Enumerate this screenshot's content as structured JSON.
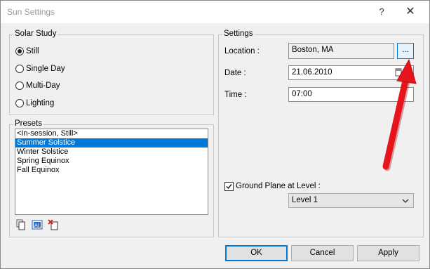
{
  "window": {
    "title": "Sun Settings",
    "help": "?",
    "close": "✕"
  },
  "solar_study": {
    "title": "Solar Study",
    "options": [
      {
        "label": "Still",
        "selected": true
      },
      {
        "label": "Single Day",
        "selected": false
      },
      {
        "label": "Multi-Day",
        "selected": false
      },
      {
        "label": "Lighting",
        "selected": false
      }
    ]
  },
  "presets": {
    "title": "Presets",
    "items": [
      "<In-session, Still>",
      "Summer Solstice",
      "Winter Solstice",
      "Spring Equinox",
      "Fall Equinox"
    ],
    "selected_index": 1,
    "icons": [
      "duplicate-icon",
      "rename-icon",
      "delete-icon"
    ]
  },
  "settings": {
    "title": "Settings",
    "location_label": "Location :",
    "location_value": "Boston, MA",
    "browse_label": "...",
    "date_label": "Date :",
    "date_value": "21.06.2010",
    "time_label": "Time :",
    "time_value": "07:00",
    "ground_plane_label": "Ground Plane at Level :",
    "ground_plane_checked": true,
    "level_value": "Level 1"
  },
  "buttons": {
    "ok": "OK",
    "cancel": "Cancel",
    "apply": "Apply"
  },
  "annotation": {
    "arrow_color": "#e8141b"
  }
}
